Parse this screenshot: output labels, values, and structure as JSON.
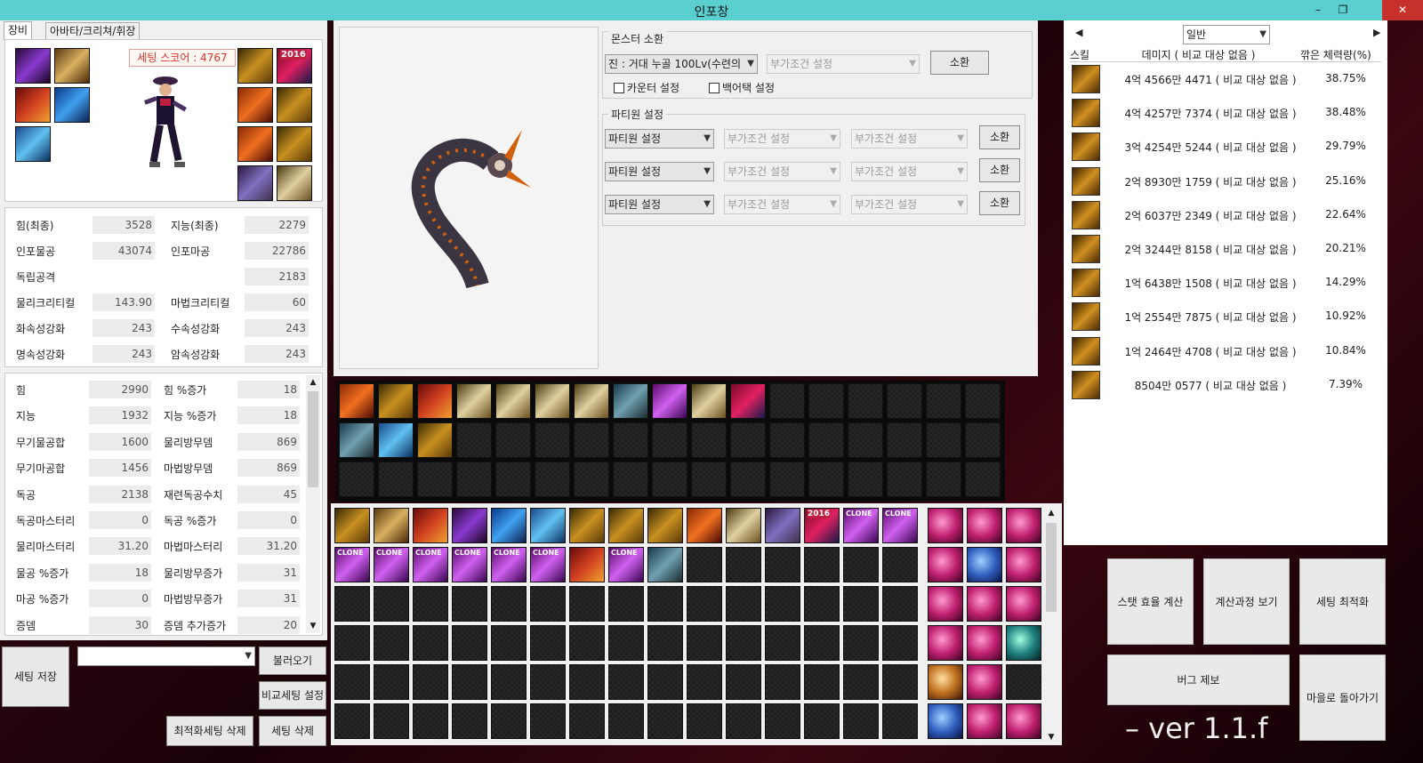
{
  "window": {
    "title": "인포창",
    "minimize": "–",
    "maximize": "❐",
    "close": "✕"
  },
  "left_tabs": [
    "장비",
    "아바타/크리쳐/휘장"
  ],
  "setting_score": "세팅 스코어 : 4767",
  "equip_badge": "2016",
  "stats_final": [
    {
      "l1": "힘(최종)",
      "v1": "3528",
      "l2": "지능(최종)",
      "v2": "2279"
    },
    {
      "l1": "인포물공",
      "v1": "43074",
      "l2": "인포마공",
      "v2": "22786"
    },
    {
      "l1": "독립공격",
      "v1": "",
      "l2": "",
      "v2": "2183"
    },
    {
      "l1": "물리크리티컬",
      "v1": "143.90",
      "l2": "마법크리티컬",
      "v2": "60"
    },
    {
      "l1": "화속성강화",
      "v1": "243",
      "l2": "수속성강화",
      "v2": "243"
    },
    {
      "l1": "명속성강화",
      "v1": "243",
      "l2": "암속성강화",
      "v2": "243"
    }
  ],
  "stats_detail": [
    {
      "l1": "힘",
      "v1": "2990",
      "l2": "힘 %증가",
      "v2": "18"
    },
    {
      "l1": "지능",
      "v1": "1932",
      "l2": "지능 %증가",
      "v2": "18"
    },
    {
      "l1": "무기물공합",
      "v1": "1600",
      "l2": "물리방무뎀",
      "v2": "869"
    },
    {
      "l1": "무기마공합",
      "v1": "1456",
      "l2": "마법방무뎀",
      "v2": "869"
    },
    {
      "l1": "독공",
      "v1": "2138",
      "l2": "재련독공수치",
      "v2": "45"
    },
    {
      "l1": "독공마스터리",
      "v1": "0",
      "l2": "독공 %증가",
      "v2": "0"
    },
    {
      "l1": "물리마스터리",
      "v1": "31.20",
      "l2": "마법마스터리",
      "v2": "31.20"
    },
    {
      "l1": "물공 %증가",
      "v1": "18",
      "l2": "물리방무증가",
      "v2": "31"
    },
    {
      "l1": "마공 %증가",
      "v1": "0",
      "l2": "마법방무증가",
      "v2": "31"
    },
    {
      "l1": "증뎀",
      "v1": "30",
      "l2": "증뎀 추가증가",
      "v2": "20"
    }
  ],
  "scroll": {
    "up": "▲",
    "down": "▼"
  },
  "left_buttons": {
    "save": "세팅 저장",
    "load": "불러오기",
    "compare": "비교세팅 설정",
    "delete_opt": "최적화세팅 삭제",
    "delete": "세팅 삭제",
    "select_arrow": "▼"
  },
  "monster": {
    "group_label": "몬스터 소환",
    "select": "진 : 거대 누골 100Lv(수련의",
    "condition": "부가조건 설정",
    "summon": "소환",
    "counter": "카운터 설정",
    "backattack": "백어택 설정"
  },
  "party": {
    "group_label": "파티원 설정",
    "rows": [
      {
        "select": "파티원 설정",
        "c1": "부가조건 설정",
        "c2": "부가조건 설정",
        "btn": "소환"
      },
      {
        "select": "파티원 설정",
        "c1": "부가조건 설정",
        "c2": "부가조건 설정",
        "btn": "소환"
      },
      {
        "select": "파티원 설정",
        "c1": "부가조건 설정",
        "c2": "부가조건 설정",
        "btn": "소환"
      }
    ]
  },
  "inventory_badges": {
    "year": "2016",
    "clone": "CLONE"
  },
  "right": {
    "nav_left": "◀",
    "nav_right": "▶",
    "mode": "일반",
    "headers": {
      "skill": "스킬",
      "damage": "데미지 ( 비교 대상 없음 )",
      "pct": "깎은 체력량(%)"
    },
    "rows": [
      {
        "dmg": "4억 4566만 4471 ( 비교 대상 없음 )",
        "pct": "38.75%"
      },
      {
        "dmg": "4억 4257만 7374 ( 비교 대상 없음 )",
        "pct": "38.48%"
      },
      {
        "dmg": "3억 4254만 5244 ( 비교 대상 없음 )",
        "pct": "29.79%"
      },
      {
        "dmg": "2억 8930만 1759 ( 비교 대상 없음 )",
        "pct": "25.16%"
      },
      {
        "dmg": "2억 6037만 2349 ( 비교 대상 없음 )",
        "pct": "22.64%"
      },
      {
        "dmg": "2억 3244만 8158 ( 비교 대상 없음 )",
        "pct": "20.21%"
      },
      {
        "dmg": "1억 6438만 1508 ( 비교 대상 없음 )",
        "pct": "14.29%"
      },
      {
        "dmg": "1억 2554만 7875 ( 비교 대상 없음 )",
        "pct": "10.92%"
      },
      {
        "dmg": "1억 2464만 4708 ( 비교 대상 없음 )",
        "pct": "10.84%"
      },
      {
        "dmg": "8504만 0577 ( 비교 대상 없음 )",
        "pct": "7.39%"
      }
    ]
  },
  "actions": {
    "stat_calc": "스탯 효율 계산",
    "view_calc": "계산과정 보기",
    "optimize": "세팅 최적화",
    "bug_report": "버그 제보",
    "go_town": "마을로 돌아가기"
  },
  "version": "– ver 1.1.f"
}
